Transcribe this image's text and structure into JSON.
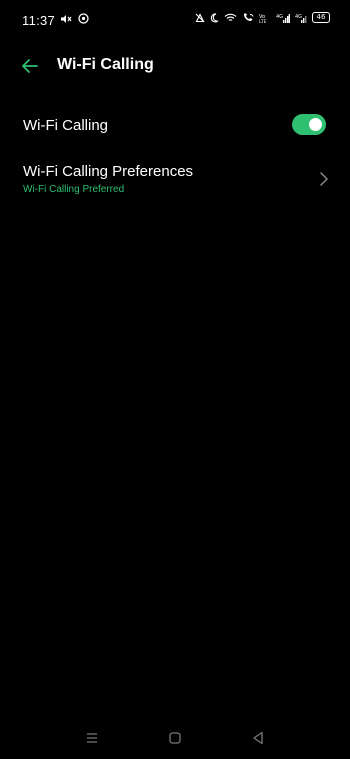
{
  "status_bar": {
    "time": "11:37",
    "battery": "46",
    "icons_left": [
      "mute-icon",
      "sync-icon"
    ],
    "icons_right": [
      "alarm-off-icon",
      "moon-icon",
      "wifi-icon",
      "wifi-call-icon",
      "volte-icon",
      "signal-icon",
      "signal-icon-2"
    ]
  },
  "header": {
    "title": "Wi-Fi Calling",
    "back_icon": "arrow-left-icon"
  },
  "settings": {
    "wifi_calling": {
      "label": "Wi-Fi Calling",
      "enabled": true
    },
    "preferences": {
      "label": "Wi-Fi Calling Preferences",
      "value": "Wi-Fi Calling Preferred"
    }
  },
  "nav_bar": {
    "buttons": [
      "menu-icon",
      "home-icon",
      "back-icon"
    ]
  },
  "colors": {
    "accent": "#2fbf71",
    "background": "#000000",
    "text": "#ffffff",
    "chevron": "#8a8a8a"
  }
}
